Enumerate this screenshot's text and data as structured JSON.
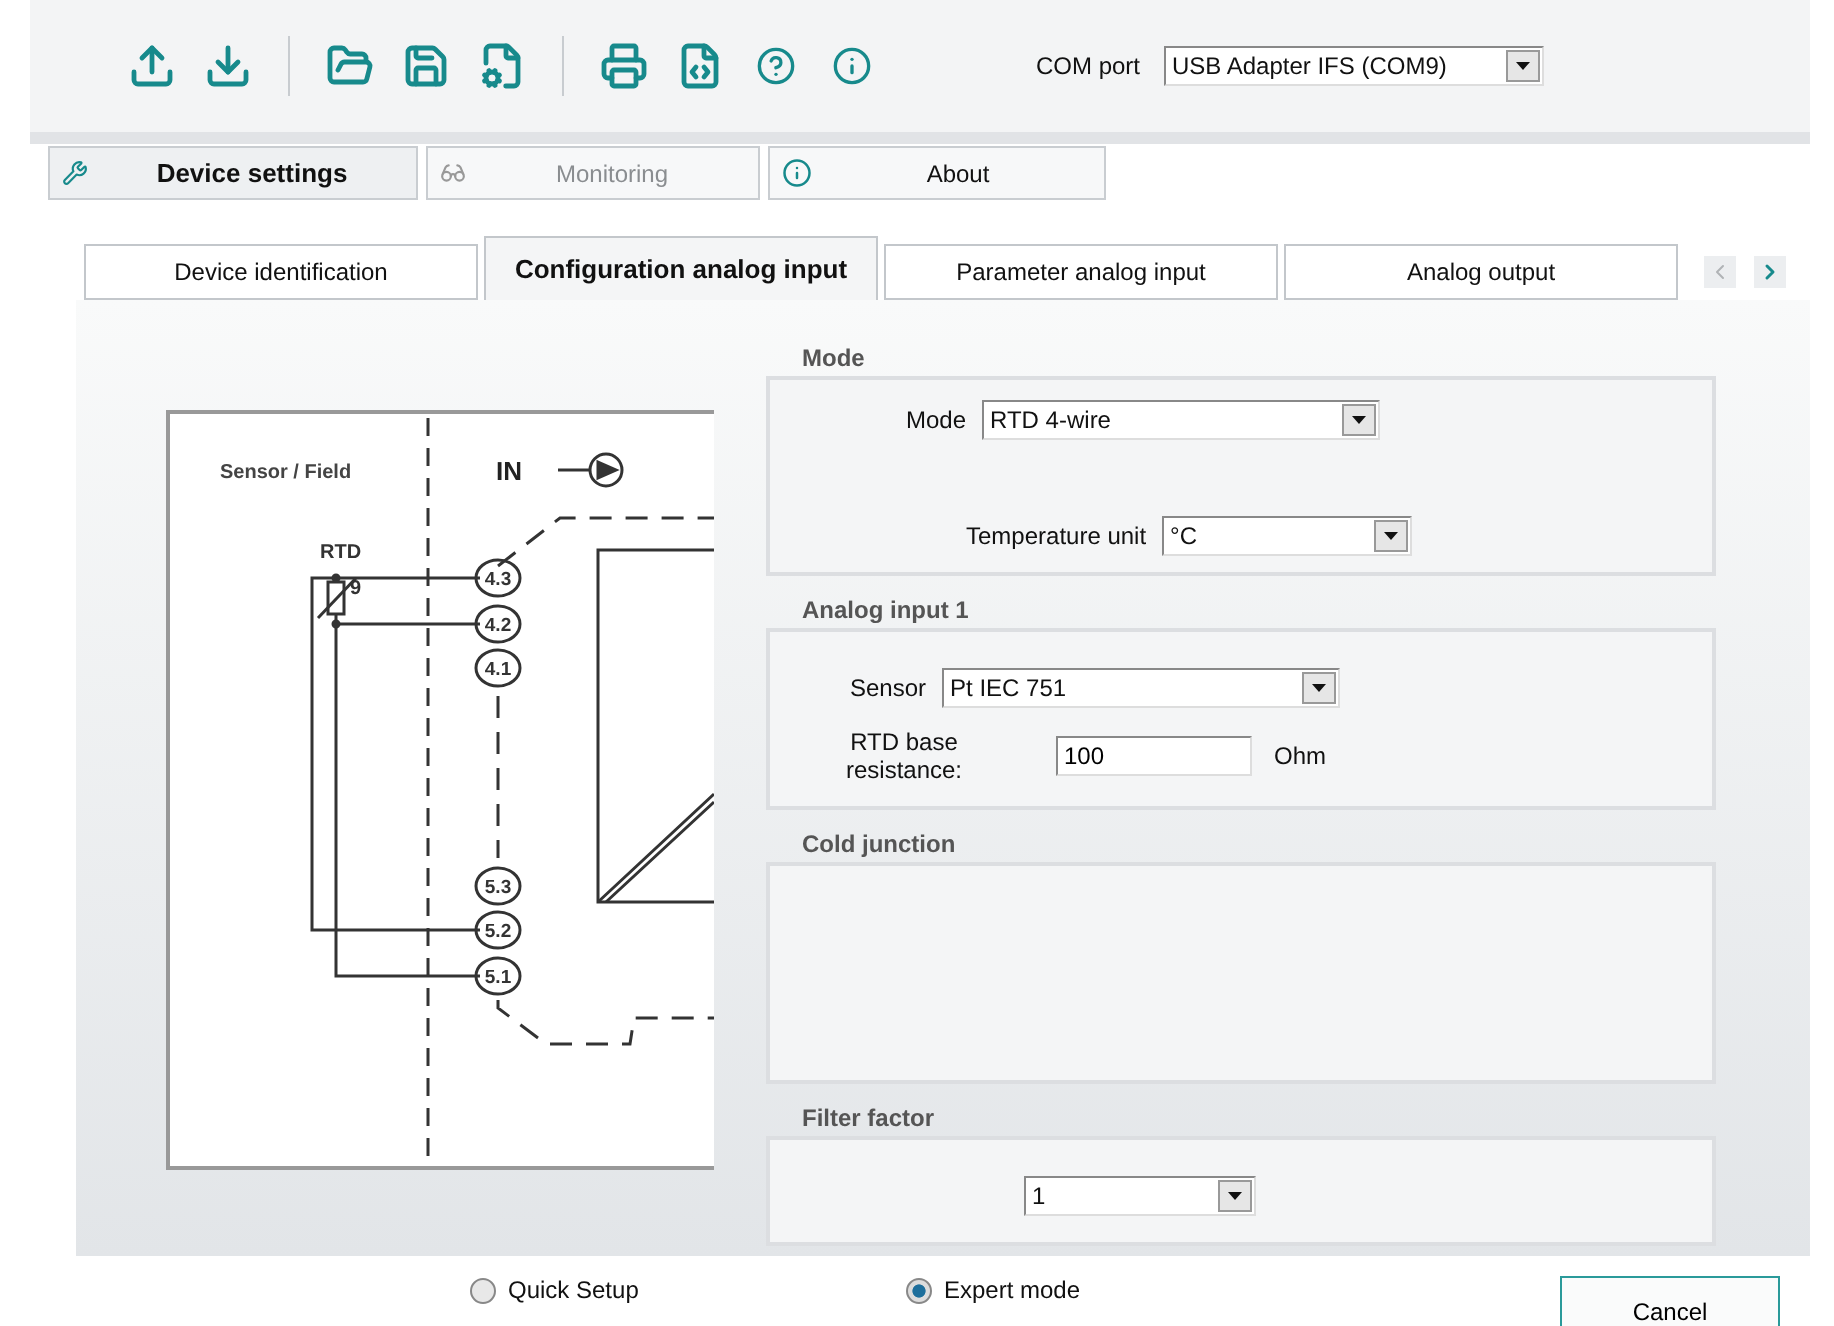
{
  "toolbar": {
    "com_port": {
      "label": "COM port",
      "value": "USB Adapter IFS (COM9)"
    }
  },
  "main_tabs": [
    {
      "kind": "settings",
      "label": "Device settings",
      "selected": true,
      "disabled": false
    },
    {
      "kind": "monitor",
      "label": "Monitoring",
      "selected": false,
      "disabled": true
    },
    {
      "kind": "info",
      "label": "About",
      "selected": false,
      "disabled": false
    }
  ],
  "sub_tabs": [
    {
      "label": "Device identification",
      "selected": false
    },
    {
      "label": "Configuration analog input",
      "selected": true
    },
    {
      "label": "Parameter analog input",
      "selected": false
    },
    {
      "label": "Analog output",
      "selected": false
    }
  ],
  "diagram": {
    "side_label": "Sensor / Field",
    "input_label": "IN",
    "sensor_label": "RTD",
    "sensor_mark": "9",
    "terminals": [
      "4.3",
      "4.2",
      "4.1",
      "5.3",
      "5.2",
      "5.1"
    ]
  },
  "sections": [
    {
      "title": "Mode",
      "fields": [
        {
          "kind": "select",
          "label": "Mode",
          "value": "RTD 4-wire"
        },
        {
          "kind": "select",
          "label": "Temperature unit",
          "value": "°C"
        }
      ]
    },
    {
      "title": "Analog input 1",
      "fields": [
        {
          "kind": "select",
          "label": "Sensor",
          "value": "Pt IEC 751"
        },
        {
          "kind": "input",
          "label": "RTD base resistance:",
          "value": "100",
          "unit": "Ohm"
        }
      ]
    },
    {
      "title": "Cold junction"
    },
    {
      "title": "Filter factor",
      "fields": [
        {
          "kind": "select",
          "value": "1"
        }
      ]
    }
  ],
  "modes": [
    {
      "label": "Quick Setup",
      "selected": false
    },
    {
      "label": "Expert mode",
      "selected": true
    }
  ],
  "buttons": [
    "Cancel"
  ]
}
